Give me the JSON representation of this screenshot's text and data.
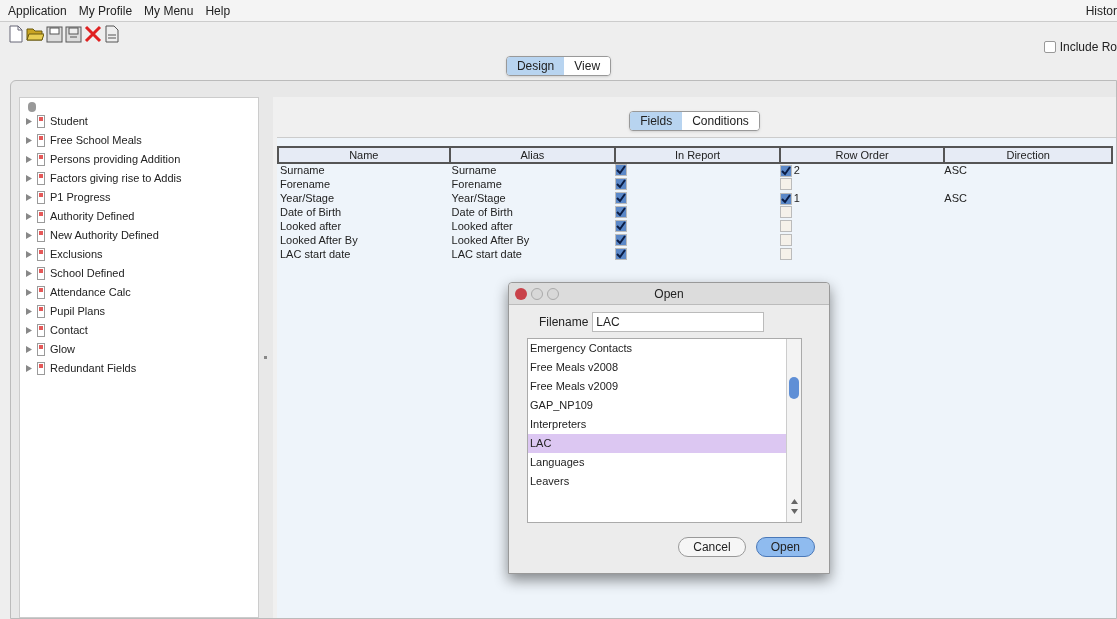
{
  "menu": [
    "Application",
    "My Profile",
    "My Menu",
    "Help"
  ],
  "history": "Histor",
  "include_checkbox": {
    "label": "Include Ro",
    "checked": false
  },
  "main_tabs": [
    {
      "label": "Design",
      "selected": true
    },
    {
      "label": "View",
      "selected": false
    }
  ],
  "tree": [
    "Student",
    "Free School Meals",
    "Persons providing Addition",
    "Factors giving rise to Addis",
    "P1 Progress",
    "Authority Defined",
    "New Authority Defined",
    "Exclusions",
    "School Defined",
    "Attendance Calc",
    "Pupil Plans",
    "Contact",
    "Glow",
    "Redundant Fields"
  ],
  "sub_tabs": [
    {
      "label": "Fields",
      "selected": true
    },
    {
      "label": "Conditions",
      "selected": false
    }
  ],
  "table": {
    "columns": [
      "Name",
      "Alias",
      "In Report",
      "Row Order",
      "Direction"
    ],
    "rows": [
      {
        "name": "Surname",
        "alias": "Surname",
        "in_report": true,
        "row_order": true,
        "order": "2",
        "direction": "ASC"
      },
      {
        "name": "Forename",
        "alias": "Forename",
        "in_report": true,
        "row_order": false
      },
      {
        "name": "Year/Stage",
        "alias": "Year/Stage",
        "in_report": true,
        "row_order": true,
        "order": "1",
        "direction": "ASC"
      },
      {
        "name": "Date of Birth",
        "alias": "Date of Birth",
        "in_report": true,
        "row_order": false
      },
      {
        "name": "Looked after",
        "alias": "Looked after",
        "in_report": true,
        "row_order": false
      },
      {
        "name": "Looked After By",
        "alias": "Looked After By",
        "in_report": true,
        "row_order": false
      },
      {
        "name": "LAC start date",
        "alias": "LAC start date",
        "in_report": true,
        "row_order": false
      }
    ]
  },
  "dialog": {
    "title": "Open",
    "filename_label": "Filename",
    "filename": "LAC",
    "files": [
      {
        "label": "Emergency Contacts",
        "selected": false
      },
      {
        "label": "Free Meals v2008",
        "selected": false
      },
      {
        "label": "Free Meals v2009",
        "selected": false
      },
      {
        "label": "GAP_NP109",
        "selected": false
      },
      {
        "label": "Interpreters",
        "selected": false
      },
      {
        "label": "LAC",
        "selected": true
      },
      {
        "label": "Languages",
        "selected": false
      },
      {
        "label": "Leavers",
        "selected": false
      }
    ],
    "buttons": [
      {
        "label": "Cancel",
        "kind": "secondary"
      },
      {
        "label": "Open",
        "kind": "primary"
      }
    ]
  }
}
